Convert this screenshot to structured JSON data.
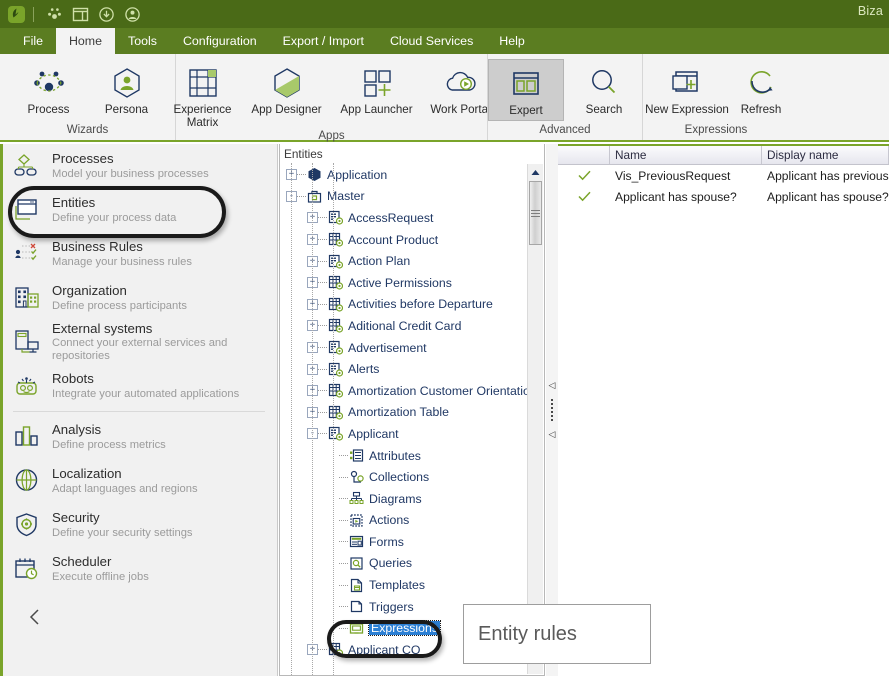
{
  "titlebar": {
    "app_title": "Biza",
    "logo_icon": "bizagi-leaf-logo",
    "quick_access": [
      {
        "name": "process-wizard-icon",
        "label": "Process wizard"
      },
      {
        "name": "window-layout-icon",
        "label": "Window layout"
      },
      {
        "name": "download-circle-icon",
        "label": "Download"
      },
      {
        "name": "person-circle-icon",
        "label": "User"
      }
    ]
  },
  "menubar": {
    "items": [
      {
        "label": "File",
        "active": false
      },
      {
        "label": "Home",
        "active": true
      },
      {
        "label": "Tools",
        "active": false
      },
      {
        "label": "Configuration",
        "active": false
      },
      {
        "label": "Export / Import",
        "active": false
      },
      {
        "label": "Cloud Services",
        "active": false
      },
      {
        "label": "Help",
        "active": false
      }
    ]
  },
  "ribbon": {
    "groups": [
      {
        "label": "Wizards",
        "buttons": [
          {
            "label": "Process",
            "icon": "process-nodes-icon",
            "selected": false
          },
          {
            "label": "Persona",
            "icon": "persona-hexagon-icon",
            "selected": false
          }
        ]
      },
      {
        "label": "Apps",
        "buttons": [
          {
            "label": "Experience\nMatrix",
            "icon": "experience-matrix-icon",
            "selected": false
          },
          {
            "label": "App Designer",
            "icon": "app-designer-hexagon-icon",
            "selected": false
          },
          {
            "label": "App Launcher",
            "icon": "app-launcher-squares-icon",
            "selected": false
          },
          {
            "label": "Work Portal",
            "icon": "cloud-play-icon",
            "selected": false
          }
        ]
      },
      {
        "label": "Advanced",
        "buttons": [
          {
            "label": "Expert",
            "icon": "expert-panes-icon",
            "selected": true
          },
          {
            "label": "Search",
            "icon": "search-magnifier-icon",
            "selected": false
          }
        ]
      },
      {
        "label": "Expressions",
        "buttons": [
          {
            "label": "New Expression",
            "icon": "new-expression-plus-icon",
            "selected": false
          },
          {
            "label": "Refresh",
            "icon": "refresh-circular-arrow-icon",
            "selected": false
          }
        ]
      }
    ]
  },
  "left_panel": {
    "modules": [
      {
        "title": "Processes",
        "desc": "Model your business processes",
        "icon": "processes-flow-icon",
        "highlighted": false
      },
      {
        "title": "Entities",
        "desc": "Define your process data",
        "icon": "entities-window-icon",
        "highlighted": true
      },
      {
        "title": "Business  Rules",
        "desc": "Manage your business rules",
        "icon": "business-rules-icon",
        "highlighted": false
      },
      {
        "title": "Organization",
        "desc": "Define process participants",
        "icon": "organization-buildings-icon",
        "highlighted": false
      },
      {
        "title": "External systems",
        "desc": "Connect your external services and repositories",
        "icon": "external-systems-icon",
        "highlighted": false
      },
      {
        "title": "Robots",
        "desc": "Integrate your automated applications",
        "icon": "robot-icon",
        "highlighted": false
      },
      {
        "title": "Analysis",
        "desc": "Define  process  metrics",
        "icon": "analysis-bars-icon",
        "highlighted": false
      },
      {
        "title": "Localization",
        "desc": "Adapt  languages  and regions",
        "icon": "localization-globe-icon",
        "highlighted": false
      },
      {
        "title": "Security",
        "desc": "Define  your  security  settings",
        "icon": "security-shield-icon",
        "highlighted": false
      },
      {
        "title": "Scheduler",
        "desc": "Execute offline jobs",
        "icon": "scheduler-calendar-clock-icon",
        "highlighted": false
      }
    ],
    "collapse_icon": "chevron-left-icon"
  },
  "tree": {
    "header": "Entities",
    "scroll_up_icon": "scroll-up-arrow-icon",
    "nodes": [
      {
        "label": "Application",
        "depth": 0,
        "expander": "+",
        "icon": "application-hexagon-icon",
        "selected": false
      },
      {
        "label": "Master",
        "depth": 0,
        "expander": "-",
        "icon": "master-briefcase-icon",
        "selected": false
      },
      {
        "label": "AccessRequest",
        "depth": 1,
        "expander": "+",
        "icon": "entity-master-icon",
        "selected": false
      },
      {
        "label": "Account Product",
        "depth": 1,
        "expander": "+",
        "icon": "entity-parametric-icon",
        "selected": false
      },
      {
        "label": "Action Plan",
        "depth": 1,
        "expander": "+",
        "icon": "entity-master-icon",
        "selected": false
      },
      {
        "label": "Active Permissions",
        "depth": 1,
        "expander": "+",
        "icon": "entity-parametric-icon",
        "selected": false
      },
      {
        "label": "Activities before Departure",
        "depth": 1,
        "expander": "+",
        "icon": "entity-parametric-icon",
        "selected": false
      },
      {
        "label": "Aditional Credit Card",
        "depth": 1,
        "expander": "+",
        "icon": "entity-parametric-icon",
        "selected": false
      },
      {
        "label": "Advertisement",
        "depth": 1,
        "expander": "+",
        "icon": "entity-master-icon",
        "selected": false
      },
      {
        "label": "Alerts",
        "depth": 1,
        "expander": "+",
        "icon": "entity-master-icon",
        "selected": false
      },
      {
        "label": "Amortization Customer Orientation",
        "depth": 1,
        "expander": "+",
        "icon": "entity-parametric-icon",
        "selected": false
      },
      {
        "label": "Amortization Table",
        "depth": 1,
        "expander": "+",
        "icon": "entity-parametric-icon",
        "selected": false
      },
      {
        "label": "Applicant",
        "depth": 1,
        "expander": "-",
        "icon": "entity-master-icon",
        "selected": false
      },
      {
        "label": "Attributes",
        "depth": 2,
        "expander": "",
        "icon": "attributes-list-icon",
        "selected": false
      },
      {
        "label": "Collections",
        "depth": 2,
        "expander": "",
        "icon": "collections-icon",
        "selected": false
      },
      {
        "label": "Diagrams",
        "depth": 2,
        "expander": "",
        "icon": "diagrams-icon",
        "selected": false
      },
      {
        "label": "Actions",
        "depth": 2,
        "expander": "",
        "icon": "actions-play-icon",
        "selected": false
      },
      {
        "label": "Forms",
        "depth": 2,
        "expander": "",
        "icon": "forms-icon",
        "selected": false
      },
      {
        "label": "Queries",
        "depth": 2,
        "expander": "",
        "icon": "queries-search-icon",
        "selected": false
      },
      {
        "label": "Templates",
        "depth": 2,
        "expander": "",
        "icon": "templates-icon",
        "selected": false
      },
      {
        "label": "Triggers",
        "depth": 2,
        "expander": "",
        "icon": "triggers-icon",
        "selected": false
      },
      {
        "label": "Expressions",
        "depth": 2,
        "expander": "",
        "icon": "expressions-window-icon",
        "selected": true
      },
      {
        "label": "Applicant CO",
        "depth": 1,
        "expander": "+",
        "icon": "entity-parametric-icon",
        "selected": false
      }
    ]
  },
  "splitter": {
    "name": "panel-splitter",
    "arrow_icon": "collapse-left-arrow-icon"
  },
  "grid": {
    "columns": [
      {
        "key": "check",
        "label": ""
      },
      {
        "key": "name",
        "label": "Name"
      },
      {
        "key": "display_name",
        "label": "Display name"
      }
    ],
    "rows": [
      {
        "check": "✓",
        "name": "Vis_PreviousRequest",
        "display_name": "Applicant has previous request"
      },
      {
        "check": "✓",
        "name": "Applicant has spouse?",
        "display_name": "Applicant has spouse?"
      }
    ]
  },
  "callout": {
    "text": "Entity rules"
  },
  "colors": {
    "title_bar": "#4a6a17",
    "menu_bar": "#5b7d21",
    "ribbon_bg": "#f3f3f3",
    "accent_green": "#7aa42a",
    "icon_navy": "#1f3864",
    "selection_blue": "#2b7fd4",
    "check_green": "#7aa42a"
  }
}
